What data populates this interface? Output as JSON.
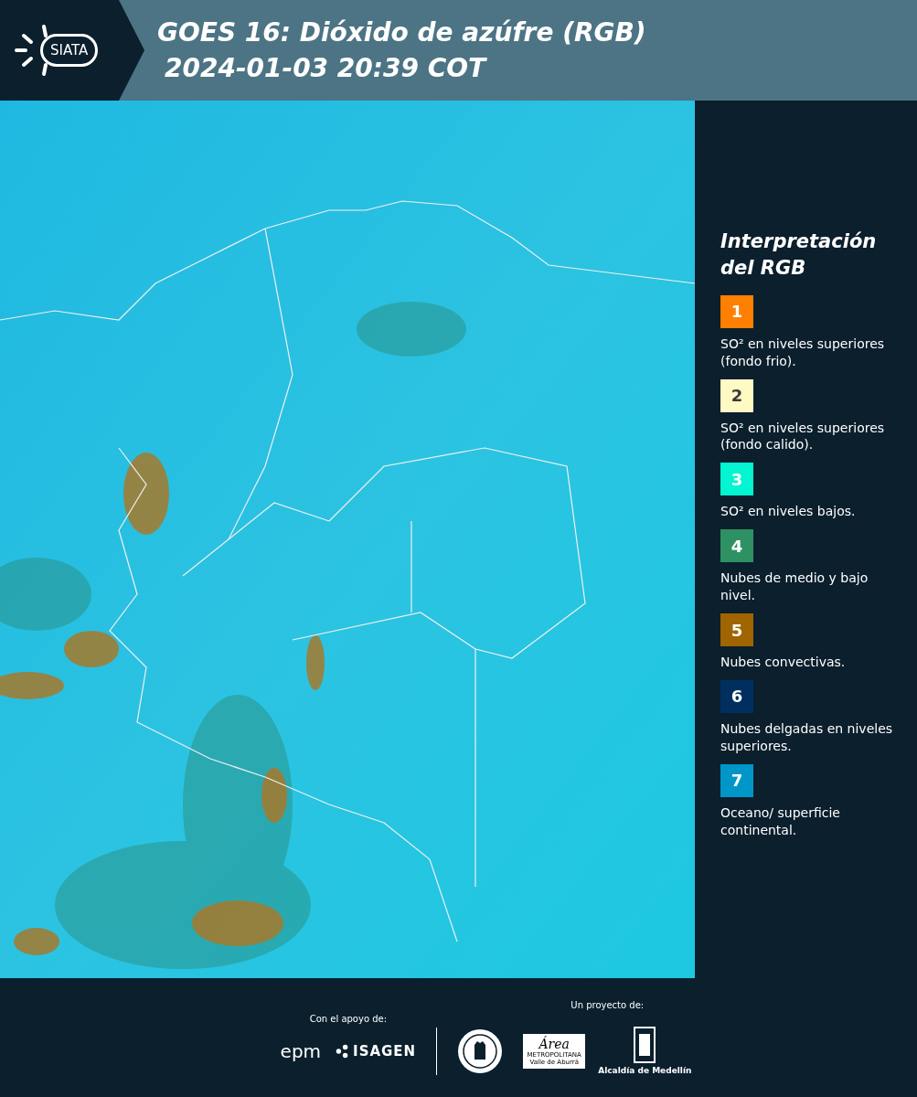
{
  "header": {
    "logo_text": "SIATA",
    "title": "GOES 16: Dióxido de azúfre (RGB)",
    "timestamp": "2024-01-03 20:39 COT"
  },
  "legend": {
    "title": "Interpretación del RGB",
    "items": [
      {
        "number": "1",
        "color": "#ff7f00",
        "label": "SO² en niveles superiores (fondo frio)."
      },
      {
        "number": "2",
        "color": "#fff9c4",
        "label": "SO² en niveles superiores (fondo calido)."
      },
      {
        "number": "3",
        "color": "#00f5d0",
        "label": "SO² en niveles bajos."
      },
      {
        "number": "4",
        "color": "#2e9164",
        "label": "Nubes de medio y bajo nivel."
      },
      {
        "number": "5",
        "color": "#a06400",
        "label": "Nubes convectivas."
      },
      {
        "number": "6",
        "color": "#002f5f",
        "label": "Nubes delgadas en niveles superiores."
      },
      {
        "number": "7",
        "color": "#0096c8",
        "label": "Oceano/ superficie continental."
      }
    ]
  },
  "footer": {
    "support_label": "Con el apoyo de:",
    "support_logos": [
      "epm",
      "ISAGEN"
    ],
    "project_label": "Un proyecto de:",
    "area_logo": {
      "name": "Área",
      "line1": "METROPOLITANA",
      "line2": "Valle de Aburrá"
    },
    "city_logo": "Alcaldía de Medellín"
  }
}
